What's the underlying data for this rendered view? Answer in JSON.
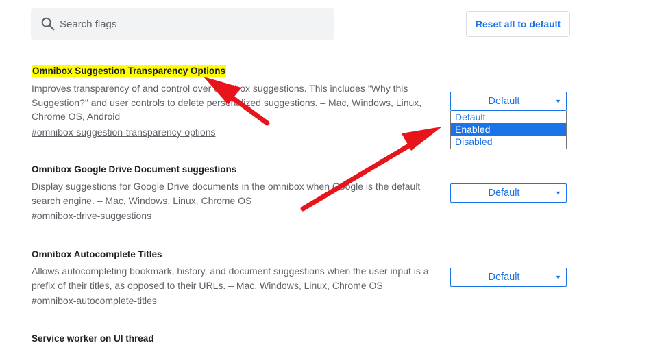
{
  "header": {
    "search": {
      "placeholder": "Search flags",
      "value": ""
    },
    "reset_label": "Reset all to default"
  },
  "flags": [
    {
      "title": "Omnibox Suggestion Transparency Options",
      "description": "Improves transparency of and control over omnibox suggestions. This includes \"Why this Suggestion?\" and user controls to delete personalized suggestions. – Mac, Windows, Linux, Chrome OS, Android",
      "link": "#omnibox-suggestion-transparency-options",
      "select_value": "Default",
      "highlighted": true
    },
    {
      "title": "Omnibox Google Drive Document suggestions",
      "description": "Display suggestions for Google Drive documents in the omnibox when Google is the default search engine. – Mac, Windows, Linux, Chrome OS",
      "link": "#omnibox-drive-suggestions",
      "select_value": "Default"
    },
    {
      "title": "Omnibox Autocomplete Titles",
      "description": "Allows autocompleting bookmark, history, and document suggestions when the user input is a prefix of their titles, as opposed to their URLs. – Mac, Windows, Linux, Chrome OS",
      "link": "#omnibox-autocomplete-titles",
      "select_value": "Default"
    },
    {
      "title": "Service worker on UI thread"
    }
  ],
  "dropdown": {
    "options": [
      "Default",
      "Enabled",
      "Disabled"
    ],
    "highlighted_option": "Enabled"
  },
  "colors": {
    "accent": "#1a73e8",
    "highlight": "#ffff00",
    "annotation_arrow": "#e8141b"
  }
}
